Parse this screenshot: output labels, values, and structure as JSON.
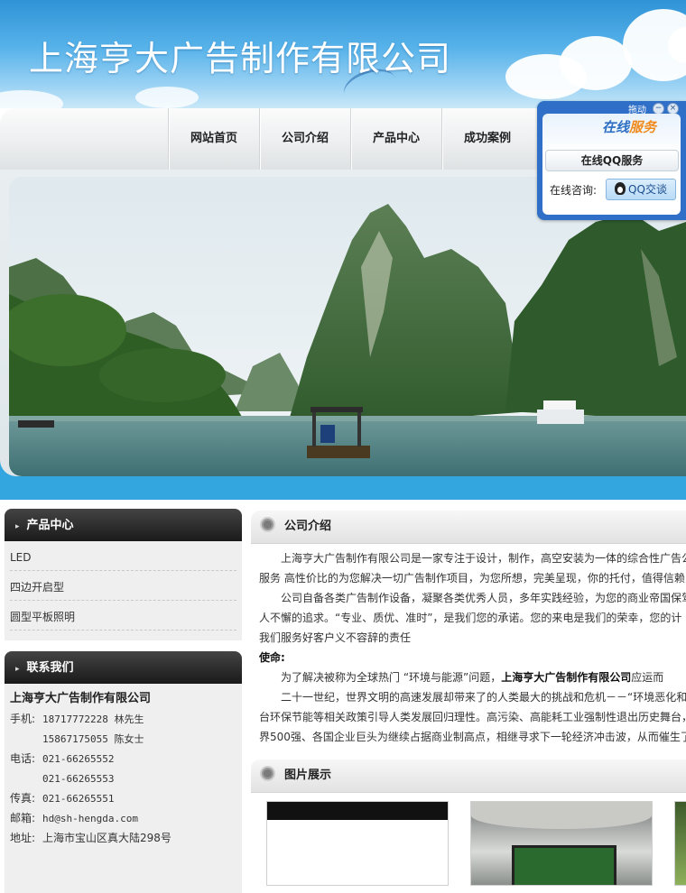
{
  "header": {
    "title": "上海亨大广告制作有限公司"
  },
  "nav": {
    "items": [
      "网站首页",
      "公司介绍",
      "产品中心",
      "成功案例"
    ]
  },
  "qq_widget": {
    "drag": "拖动",
    "online_a": "在线",
    "online_b": "服务",
    "service_title": "在线QQ服务",
    "consult_label": "在线咨询:",
    "qq_button": "QQ交谈"
  },
  "products": {
    "title": "产品中心",
    "items": [
      "LED",
      "四边开启型",
      "圆型平板照明"
    ]
  },
  "contact": {
    "title": "联系我们",
    "company": "上海亨大广告制作有限公司",
    "mobile_label": "手机:",
    "mobile1": "18717772228 林先生",
    "mobile2": "15867175055 陈女士",
    "tel_label": "电话:",
    "tel1": "021-66265552",
    "tel2": "021-66265553",
    "fax_label": "传真:",
    "fax": "021-66265551",
    "email_label": "邮箱:",
    "email": "hd@sh-hengda.com",
    "address_label": "地址:",
    "address": "上海市宝山区真大陆298号"
  },
  "intro": {
    "title": "公司介绍",
    "lines": [
      "上海亨大广告制作有限公司是一家专注于设计，制作，高空安装为一体的综合性广告公",
      "服务 高性价比的为您解决一切广告制作项目，为您所想，完美呈现，你的托付，值得信赖",
      "公司自备各类广告制作设备，凝聚各类优秀人员，多年实践经验，为您的商业帝国保驾",
      "人不懈的追求。“专业、质优、准时”，是我们您的承诺。您的来电是我们的荣幸，您的计",
      "我们服务好客户义不容辞的责任"
    ],
    "mission_label": "使命:",
    "mission_pre": "为了解决被称为全球热门 “环境与能源”问题，",
    "mission_bold": "上海亨大广告制作有限公司",
    "mission_post": "应运而",
    "lines2": [
      "二十一世纪，世界文明的高速发展却带来了的人类最大的挑战和危机－－“环境恶化和",
      "台环保节能等相关政策引导人类发展回归理性。高污染、高能耗工业强制性退出历史舞台，",
      "界500强、各国企业巨头为继续占据商业制高点，相继寻求下一轮经济冲击波，从而催生了"
    ]
  },
  "gallery": {
    "title": "图片展示"
  }
}
